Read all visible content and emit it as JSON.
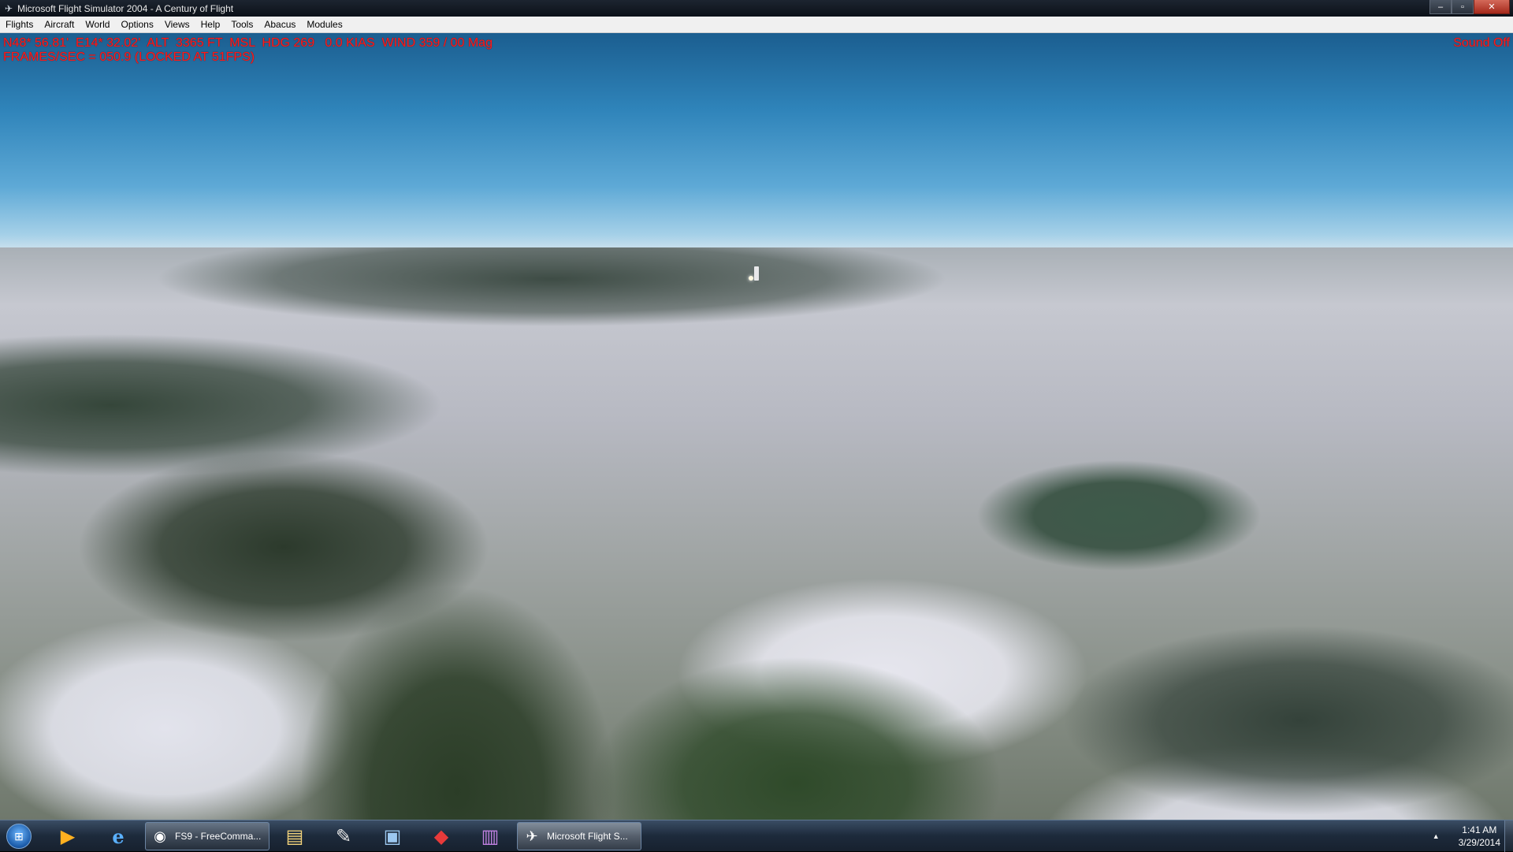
{
  "window": {
    "title": "Microsoft Flight Simulator 2004 - A Century of Flight",
    "app_icon": "plane-icon",
    "minimize_label": "–",
    "maximize_label": "▫",
    "close_label": "✕"
  },
  "menu": {
    "items": [
      "Flights",
      "Aircraft",
      "World",
      "Options",
      "Views",
      "Help",
      "Tools",
      "Abacus",
      "Modules"
    ]
  },
  "hud": {
    "line1": "N48* 56.81'  E14* 32.02'  ALT  3365 FT  MSL  HDG 269   0.0 KIAS  WIND 359 / 00 Mag",
    "line2": "FRAMES/SEC = 050.9 (LOCKED AT 51FPS)",
    "sound": "Sound Off",
    "text_color": "#ff1a1a"
  },
  "taskbar": {
    "start_icon": "windows-orb-icon",
    "pinned": [
      {
        "name": "media-player-icon",
        "glyph": "▶"
      },
      {
        "name": "internet-explorer-icon",
        "glyph": "e"
      }
    ],
    "apps": [
      {
        "label": "FS9 - FreeComma...",
        "icon": "fs9-freecommander-icon"
      },
      {
        "label": "Microsoft Flight S...",
        "icon": "flight-simulator-icon"
      }
    ],
    "more_pinned": [
      {
        "name": "file-explorer-icon",
        "glyph": "▤"
      },
      {
        "name": "paint-icon",
        "glyph": "✎"
      },
      {
        "name": "control-panel-icon",
        "glyph": "▣"
      },
      {
        "name": "colorful-app-icon",
        "glyph": "◆"
      },
      {
        "name": "winrar-icon",
        "glyph": "▥"
      }
    ],
    "clock_time": "1:41 AM",
    "clock_date": "3/29/2014",
    "tray_arrow": "▲"
  }
}
